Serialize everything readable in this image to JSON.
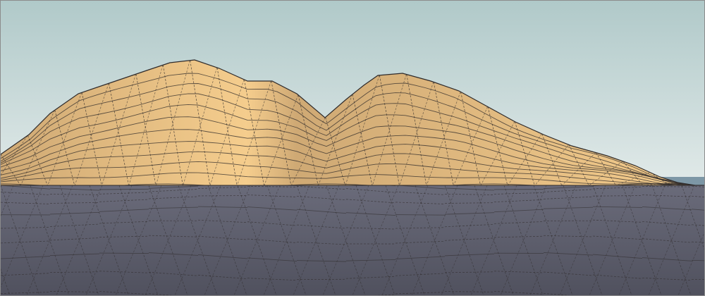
{
  "viewport": {
    "sky_top": "#b0c9c9",
    "sky_bottom": "#e3ebea",
    "terrain_light": "#f5cd8d",
    "terrain_shade": "#cfa974",
    "ground_light": "#6a6b7a",
    "ground_dark": "#50515e",
    "edge_color": "#2e2a2a",
    "water_color": "#7d97a6",
    "frame_color": "#8c8c8c"
  },
  "scene": {
    "model_type": "terrain-mesh",
    "edges_shown": true,
    "hidden_geometry_shown": true
  }
}
